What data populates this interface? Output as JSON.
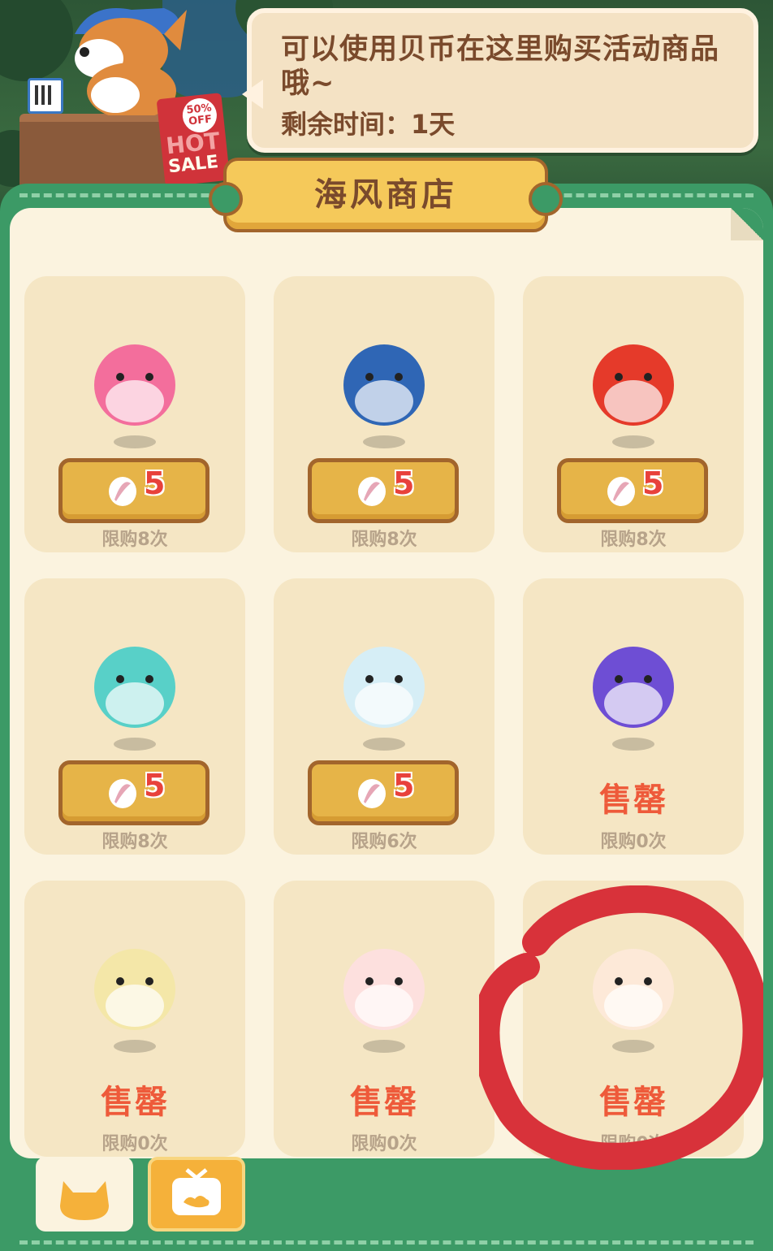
{
  "speech_bubble": {
    "message": "可以使用贝币在这里购买活动商品哦~",
    "remaining_time": "剩余时间：1天"
  },
  "hot_sale_sign": {
    "discount": "50%",
    "off": "OFF",
    "hot": "HOT",
    "sale": "SALE"
  },
  "shop": {
    "title": "海风商店"
  },
  "items": [
    {
      "name": "pink-fox",
      "price": "5",
      "sold_out": false,
      "limit": "限购8次",
      "color": "#f36e9c"
    },
    {
      "name": "blue-pangolin",
      "price": "5",
      "sold_out": false,
      "limit": "限购8次",
      "color": "#2f66b5"
    },
    {
      "name": "red-bird",
      "price": "5",
      "sold_out": false,
      "limit": "限购8次",
      "color": "#e53a2a"
    },
    {
      "name": "jellyfish",
      "price": "5",
      "sold_out": false,
      "limit": "限购8次",
      "color": "#58d0c8"
    },
    {
      "name": "panda-ball",
      "price": "5",
      "sold_out": false,
      "limit": "限购6次",
      "color": "#d6eef6"
    },
    {
      "name": "purple-cat",
      "sold_out": true,
      "sold_out_label": "售罄",
      "limit": "限购0次",
      "color": "#6e4ed4"
    },
    {
      "name": "mouse",
      "sold_out": true,
      "sold_out_label": "售罄",
      "limit": "限购0次",
      "color": "#f4e7a8"
    },
    {
      "name": "crane",
      "sold_out": true,
      "sold_out_label": "售罄",
      "limit": "限购0次",
      "color": "#fde0de"
    },
    {
      "name": "sheep",
      "sold_out": true,
      "sold_out_label": "售罄",
      "limit": "限购0次",
      "color": "#fde9d8"
    }
  ],
  "tabs": [
    {
      "icon": "cat-icon",
      "color": "#f5b13a"
    },
    {
      "icon": "tv-icon",
      "color": "#f5b13a"
    }
  ],
  "annotation": {
    "color": "#d8323a"
  }
}
